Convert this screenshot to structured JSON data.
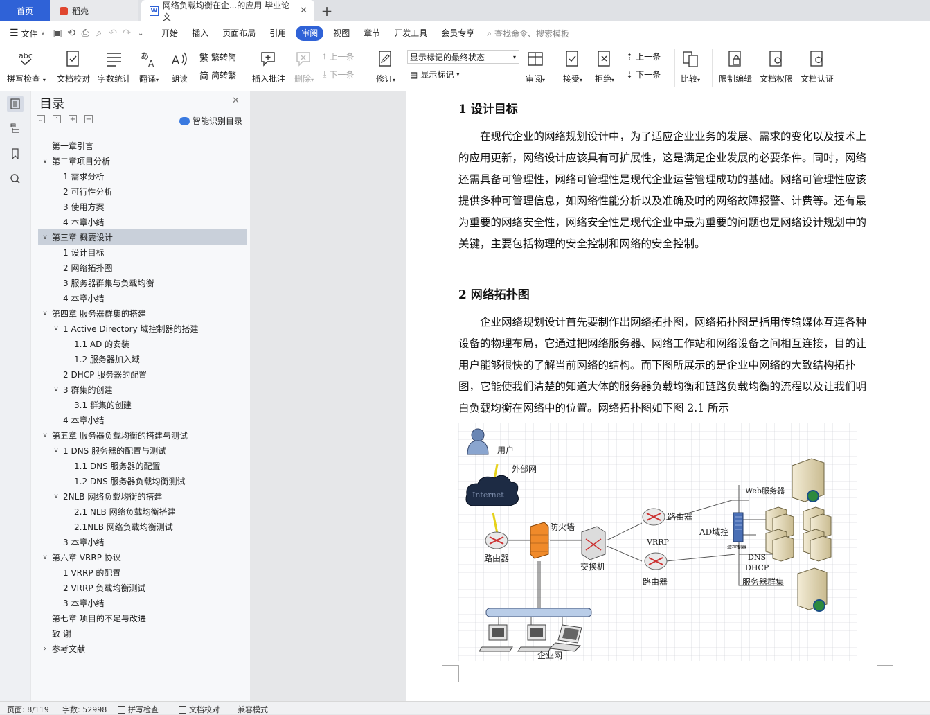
{
  "tabs": {
    "home": "首页",
    "daoke": "稻壳",
    "doc": "网络负载均衡在企...的应用 毕业论文"
  },
  "menu": {
    "file": "文件",
    "items": [
      "开始",
      "插入",
      "页面布局",
      "引用",
      "审阅",
      "视图",
      "章节",
      "开发工具",
      "会员专享"
    ],
    "search": "查找命令、搜索模板"
  },
  "ribbon": {
    "spell": "拼写检查",
    "proof": "文档校对",
    "wordcount": "字数统计",
    "translate": "翻译",
    "read": "朗读",
    "trad": "繁转简",
    "simp": "简转繁",
    "insert_comment": "插入批注",
    "delete": "删除",
    "prev_comment": "上一条",
    "next_comment": "下一条",
    "revise": "修订",
    "markup_select": "显示标记的最终状态",
    "show_markup": "显示标记",
    "review": "审阅",
    "accept": "接受",
    "reject": "拒绝",
    "prev_change": "上一条",
    "next_change": "下一条",
    "compare": "比较",
    "restrict": "限制编辑",
    "doc_perm": "文档权限",
    "doc_auth": "文档认证"
  },
  "nav": {
    "title": "目录",
    "smart": "智能识别目录",
    "items": [
      "第一章引言",
      "第二章项目分析",
      "1  需求分析",
      "2  可行性分析",
      "3  使用方案",
      "4 本章小结",
      "第三章  概要设计",
      "1 设计目标",
      "2 网络拓扑图",
      "3 服务器群集与负载均衡",
      "4 本章小结",
      "第四章  服务器群集的搭建",
      "1    Active Directory 域控制器的搭建",
      "1.1    AD 的安装",
      "1.2  服务器加入域",
      "2    DHCP 服务器的配置",
      "3    群集的创建",
      "3.1  群集的创建",
      "4    本章小结",
      "第五章  服务器负载均衡的搭建与测试",
      "1    DNS 服务器的配置与测试",
      "1.1    DNS 服务器的配置",
      "1.2 DNS 服务器负载均衡测试",
      "2NLB 网络负载均衡的搭建",
      "2.1    NLB 网络负载均衡搭建",
      "2.1NLB 网络负载均衡测试",
      "3    本章小结",
      "第六章  VRRP 协议",
      "1 VRRP 的配置",
      "2 VRRP 负载均衡测试",
      "3  本章小结",
      "第七章  项目的不足与改进",
      "致    谢",
      "参考文献"
    ]
  },
  "doc": {
    "h1": "1 设计目标",
    "p1": [
      "在现代企业的网络规划设计中，为了适应企业业务的发展、需求的变化以及技术上",
      "的应用更新，网络设计应该具有可扩展性，这是满足企业发展的必要条件。同时，网络",
      "还需具备可管理性，网络可管理性是现代企业运营管理成功的基础。网络可管理性应该",
      "提供多种可管理信息，如网络性能分析以及准确及时的网络故障报警、计费等。还有最",
      "为重要的网络安全性，网络安全性是现代企业中最为重要的问题也是网络设计规划中的",
      "关键，主要包括物理的安全控制和网络的安全控制。"
    ],
    "h2": "2 网络拓扑图",
    "p2": [
      "企业网络规划设计首先要制作出网络拓扑图，网络拓扑图是指用传输媒体互连各种",
      "设备的物理布局，它通过把网络服务器、网络工作站和网络设备之间相互连接，目的让",
      "用户能够很快的了解当前网络的结构。而下图所展示的是企业中网络的大致结构拓扑",
      "图，它能使我们清楚的知道大体的服务器负载均衡和链路负载均衡的流程以及让我们明",
      "白负载均衡在网络中的位置。网络拓扑图如下图 2.1 所示"
    ],
    "diagram": {
      "user": "用户",
      "wan": "外部网",
      "internet": "Internet",
      "router1": "路由器",
      "firewall": "防火墙",
      "switch": "交换机",
      "router2": "路由器",
      "router3": "路由器",
      "vrrp": "VRRP",
      "ad": "AD域控",
      "dc": "域控制器",
      "web": "Web服务器",
      "dns": "DNS",
      "dhcp": "DHCP",
      "cluster": "服务器群集",
      "lan": "企业网"
    }
  },
  "status": {
    "page": "页面: 8/119",
    "words": "字数: 52998",
    "spell": "拼写检查",
    "proof": "文档校对",
    "compat": "兼容模式"
  }
}
